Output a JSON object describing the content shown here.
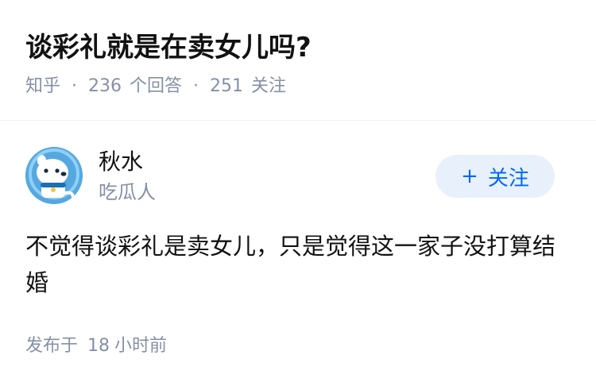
{
  "question": {
    "title": "谈彩礼就是在卖女儿吗?",
    "source": "知乎",
    "separator": "·",
    "answer_count": "236",
    "answer_label": "个回答",
    "follower_count": "251",
    "follower_label": "关注"
  },
  "answer": {
    "author": {
      "name": "秋水",
      "headline": "吃瓜人",
      "avatar_icon": "dog-cartoon-avatar"
    },
    "follow_button": {
      "icon": "+",
      "label": "关注"
    },
    "content": "不觉得谈彩礼是卖女儿，只是觉得这一家子没打算结婚",
    "time_prefix": "发布于",
    "time_value": "18",
    "time_unit": "小时前"
  },
  "colors": {
    "title": "#121212",
    "meta": "#8590a6",
    "follow_bg": "#e8f1fb",
    "follow_text": "#0066ff",
    "avatar_bg": "#56a8e0"
  }
}
